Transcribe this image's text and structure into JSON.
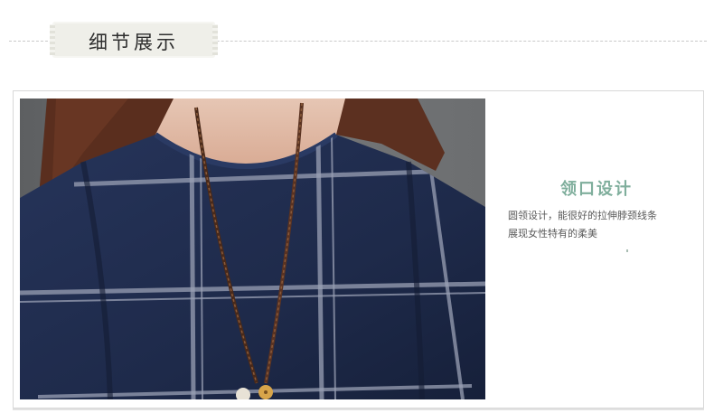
{
  "header": {
    "title": "细节展示"
  },
  "feature": {
    "title": "领口设计",
    "desc_line1": "圆领设计，能很好的拉伸脖颈线条",
    "desc_line2": "展现女性特有的柔美"
  },
  "colors": {
    "accent": "#7fae9c",
    "shirt": "#1f2a4a",
    "background_wall": "#6a6c6e"
  }
}
